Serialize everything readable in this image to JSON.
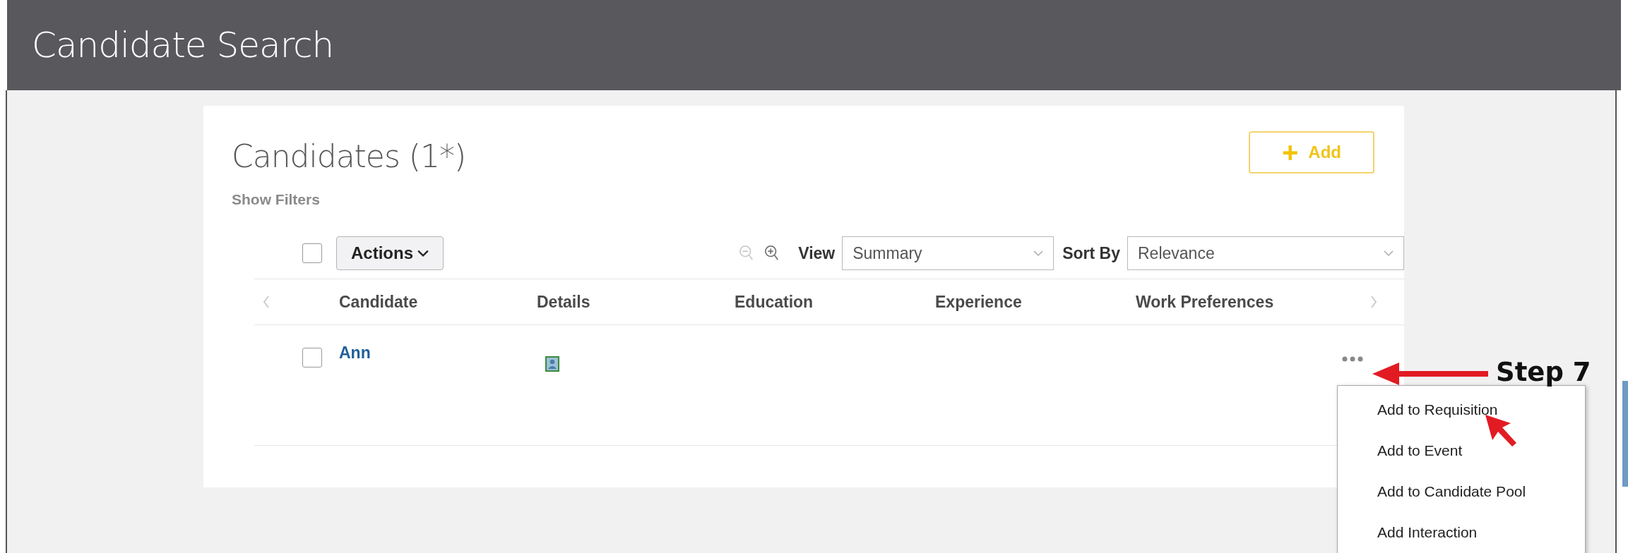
{
  "header": {
    "title": "Candidate Search"
  },
  "card": {
    "title": "Candidates (1*)",
    "filter_link": "Show Filters",
    "add_button": {
      "icon": "+",
      "label": "Add"
    }
  },
  "toolbar": {
    "select_all": {
      "checked": false
    },
    "actions": "Actions",
    "view_label": "View",
    "view_value": "Summary",
    "sort_label": "Sort By",
    "sort_value": "Relevance"
  },
  "table": {
    "columns": [
      "Candidate",
      "Details",
      "Education",
      "Experience",
      "Work Preferences"
    ],
    "rows": [
      {
        "name": "Ann",
        "checked": false
      }
    ]
  },
  "row_menu": {
    "items": [
      "Add to Requisition",
      "Add to Event",
      "Add to Candidate Pool",
      "Add Interaction"
    ]
  },
  "annotation": {
    "label": "Step 7"
  }
}
